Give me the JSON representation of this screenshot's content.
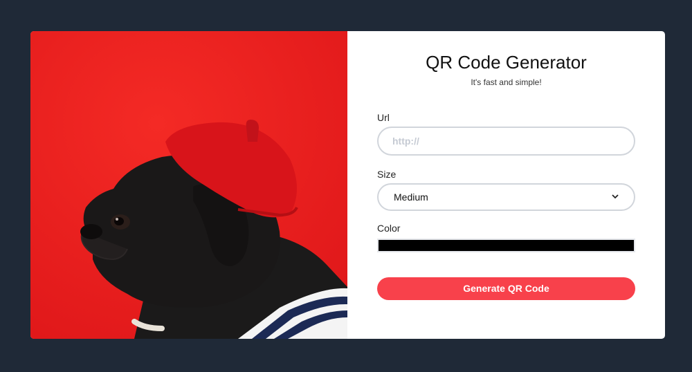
{
  "colors": {
    "page_background": "#1f2937",
    "card_background": "#ffffff",
    "photo_background": "#ec1e1e",
    "button_accent": "#f8414b",
    "selected_color": "#000000"
  },
  "form": {
    "title": "QR Code Generator",
    "subtitle": "It's fast and simple!",
    "url": {
      "label": "Url",
      "placeholder": "http://",
      "value": ""
    },
    "size": {
      "label": "Size",
      "selected": "Medium"
    },
    "color": {
      "label": "Color",
      "value": "#000000"
    },
    "submit_label": "Generate QR Code"
  },
  "icons": {
    "size_dropdown": "chevron-down-icon"
  }
}
